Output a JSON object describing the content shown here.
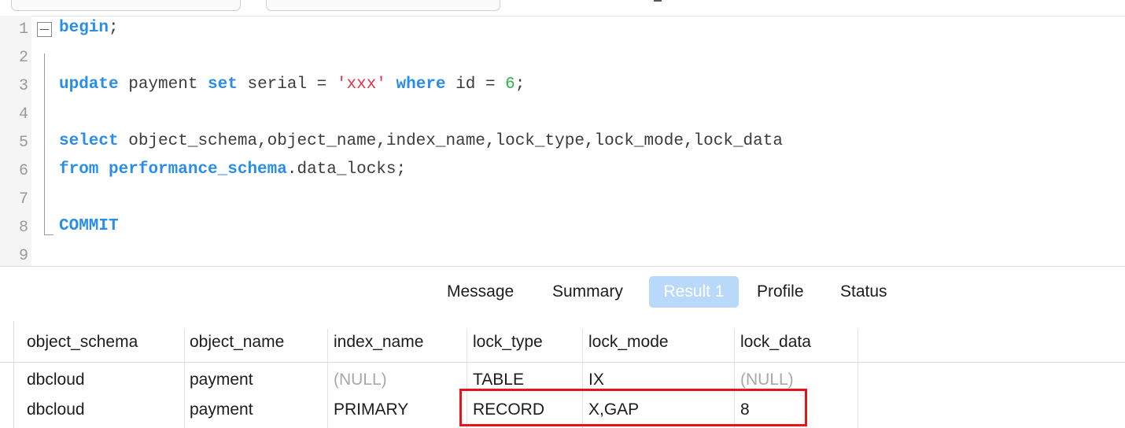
{
  "editor": {
    "lines": [
      {
        "n": "1",
        "tokens": [
          {
            "t": "begin",
            "c": "kw"
          },
          {
            "t": ";",
            "c": "plain"
          }
        ]
      },
      {
        "n": "2",
        "tokens": []
      },
      {
        "n": "3",
        "tokens": [
          {
            "t": "update",
            "c": "kw"
          },
          {
            "t": " payment ",
            "c": "plain"
          },
          {
            "t": "set",
            "c": "kw"
          },
          {
            "t": " serial = ",
            "c": "plain"
          },
          {
            "t": "'xxx'",
            "c": "str"
          },
          {
            "t": " ",
            "c": "plain"
          },
          {
            "t": "where",
            "c": "kw"
          },
          {
            "t": " id = ",
            "c": "plain"
          },
          {
            "t": "6",
            "c": "num"
          },
          {
            "t": ";",
            "c": "plain"
          }
        ]
      },
      {
        "n": "4",
        "tokens": []
      },
      {
        "n": "5",
        "tokens": [
          {
            "t": "select",
            "c": "kw"
          },
          {
            "t": " object_schema,object_name,index_name,lock_type,lock_mode,lock_data",
            "c": "plain"
          }
        ]
      },
      {
        "n": "6",
        "tokens": [
          {
            "t": "from",
            "c": "kw"
          },
          {
            "t": " ",
            "c": "plain"
          },
          {
            "t": "performance_schema",
            "c": "kw"
          },
          {
            "t": ".data_locks;",
            "c": "plain"
          }
        ]
      },
      {
        "n": "7",
        "tokens": []
      },
      {
        "n": "8",
        "tokens": [
          {
            "t": "COMMIT",
            "c": "kw"
          }
        ]
      },
      {
        "n": "9",
        "tokens": []
      }
    ]
  },
  "tabs": [
    {
      "label": "Message",
      "active": false
    },
    {
      "label": "Summary",
      "active": false
    },
    {
      "label": "Result 1",
      "active": true
    },
    {
      "label": "Profile",
      "active": false
    },
    {
      "label": "Status",
      "active": false
    }
  ],
  "result": {
    "columns": [
      "object_schema",
      "object_name",
      "index_name",
      "lock_type",
      "lock_mode",
      "lock_data"
    ],
    "rows": [
      [
        "dbcloud",
        "payment",
        "(NULL)",
        "TABLE",
        "IX",
        "(NULL)"
      ],
      [
        "dbcloud",
        "payment",
        "PRIMARY",
        "RECORD",
        "X,GAP",
        "8"
      ]
    ]
  },
  "colors": {
    "keyword": "#2a8ee8",
    "string": "#e0334d",
    "number": "#2fb34a",
    "active_tab": "#b9d9fb",
    "highlight_box": "#e8141c",
    "null_text": "#a8a8a8"
  }
}
